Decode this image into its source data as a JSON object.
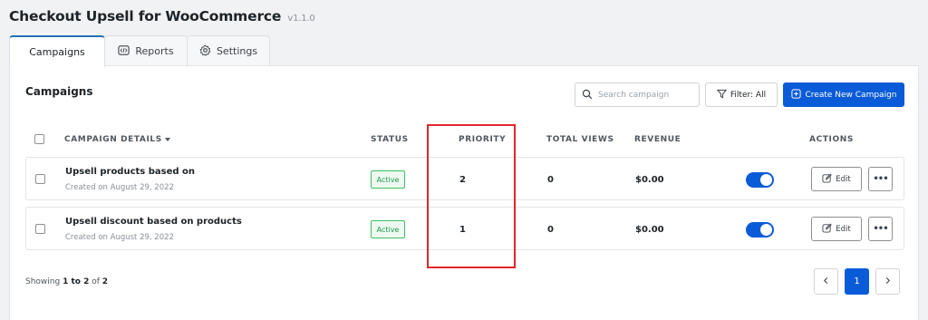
{
  "header": {
    "title": "Checkout Upsell for WooCommerce",
    "version": "v1.1.0"
  },
  "tabs": [
    {
      "label": "Campaigns",
      "active": true,
      "icon": ""
    },
    {
      "label": "Reports",
      "active": false,
      "icon": "reports-icon"
    },
    {
      "label": "Settings",
      "active": false,
      "icon": "gear-icon"
    }
  ],
  "panel": {
    "title": "Campaigns"
  },
  "toolbar": {
    "search_placeholder": "Search campaign",
    "filter_label": "Filter: All",
    "create_label": "Create New Campaign"
  },
  "table": {
    "columns": [
      "CAMPAIGN DETAILS",
      "STATUS",
      "PRIORITY",
      "TOTAL VIEWS",
      "REVENUE",
      "ACTIONS"
    ],
    "rows": [
      {
        "name": "Upsell products based on",
        "created": "Created on August 29, 2022",
        "status": "Active",
        "priority": "2",
        "views": "0",
        "revenue": "$0.00",
        "enabled": true,
        "edit_label": "Edit",
        "more_label": "•••"
      },
      {
        "name": "Upsell discount based on products",
        "created": "Created on August 29, 2022",
        "status": "Active",
        "priority": "1",
        "views": "0",
        "revenue": "$0.00",
        "enabled": true,
        "edit_label": "Edit",
        "more_label": "•••"
      }
    ]
  },
  "footer": {
    "showing_prefix": "Showing",
    "range": "1 to 2",
    "of_label": "of",
    "total": "2",
    "current_page": "1"
  },
  "colors": {
    "accent": "#0a5bd8",
    "active_badge": "#1f9d48",
    "highlight": "#e0262b"
  }
}
